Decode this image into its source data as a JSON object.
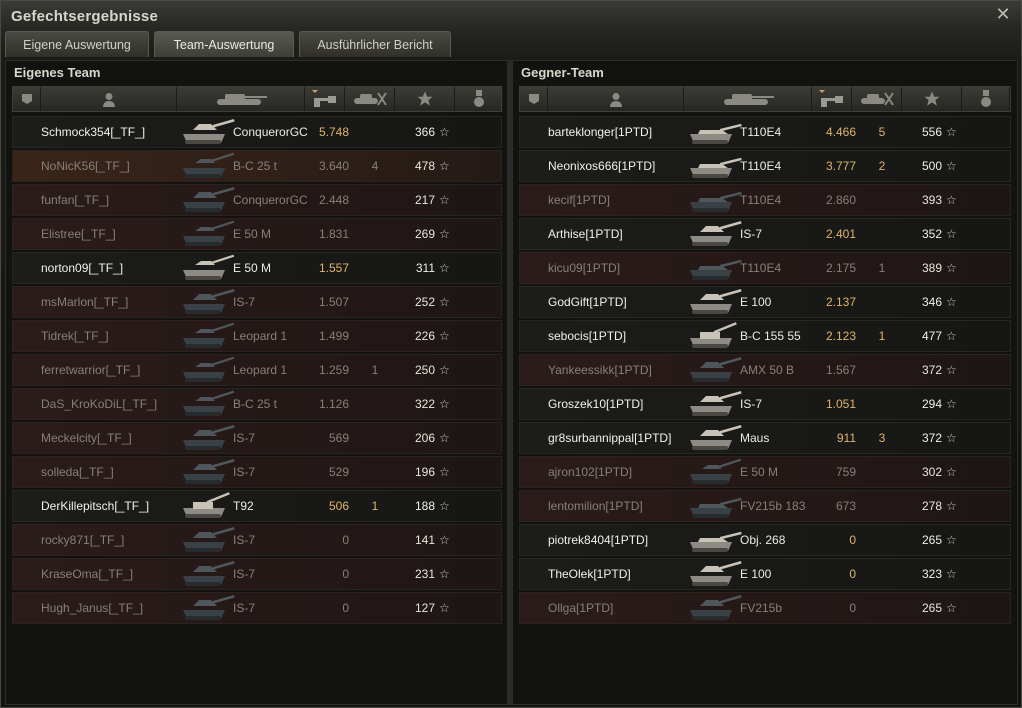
{
  "window": {
    "title": "Gefechtsergebnisse",
    "close_icon": "close-icon"
  },
  "tabs": [
    {
      "label": "Eigene Auswertung",
      "active": false
    },
    {
      "label": "Team-Auswertung",
      "active": true
    },
    {
      "label": "Ausführlicher Bericht",
      "active": false
    }
  ],
  "colors": {
    "damage": "#e0b36a",
    "dead_row": "#2a1c1a",
    "alive_row": "#1c1c1a"
  },
  "own_team": {
    "title": "Eigenes Team",
    "players": [
      {
        "name": "Schmock354[_TF_]",
        "vehicle": "ConquerorGC",
        "damage": "5.748",
        "kills": "",
        "xp": "366",
        "alive": true,
        "tank": "heavy"
      },
      {
        "name": "NoNicK56[_TF_]",
        "vehicle": "B-C 25 t",
        "damage": "3.640",
        "kills": "4",
        "xp": "478",
        "alive": false,
        "tank": "medium",
        "highlight": true
      },
      {
        "name": "funfan[_TF_]",
        "vehicle": "ConquerorGC",
        "damage": "2.448",
        "kills": "",
        "xp": "217",
        "alive": false,
        "tank": "heavy"
      },
      {
        "name": "Elistree[_TF_]",
        "vehicle": "E 50 M",
        "damage": "1.831",
        "kills": "",
        "xp": "269",
        "alive": false,
        "tank": "medium"
      },
      {
        "name": "norton09[_TF_]",
        "vehicle": "E 50 M",
        "damage": "1.557",
        "kills": "",
        "xp": "311",
        "alive": true,
        "tank": "medium"
      },
      {
        "name": "msMarlon[_TF_]",
        "vehicle": "IS-7",
        "damage": "1.507",
        "kills": "",
        "xp": "252",
        "alive": false,
        "tank": "heavy"
      },
      {
        "name": "Tidrek[_TF_]",
        "vehicle": "Leopard 1",
        "damage": "1.499",
        "kills": "",
        "xp": "226",
        "alive": false,
        "tank": "medium"
      },
      {
        "name": "ferretwarrior[_TF_]",
        "vehicle": "Leopard 1",
        "damage": "1.259",
        "kills": "1",
        "xp": "250",
        "alive": false,
        "tank": "medium"
      },
      {
        "name": "DaS_KroKoDiL[_TF_]",
        "vehicle": "B-C 25 t",
        "damage": "1.126",
        "kills": "",
        "xp": "322",
        "alive": false,
        "tank": "medium"
      },
      {
        "name": "Meckelcity[_TF_]",
        "vehicle": "IS-7",
        "damage": "569",
        "kills": "",
        "xp": "206",
        "alive": false,
        "tank": "heavy"
      },
      {
        "name": "solleda[_TF_]",
        "vehicle": "IS-7",
        "damage": "529",
        "kills": "",
        "xp": "196",
        "alive": false,
        "tank": "heavy"
      },
      {
        "name": "DerKillepitsch[_TF_]",
        "vehicle": "T92",
        "damage": "506",
        "kills": "1",
        "xp": "188",
        "alive": true,
        "tank": "spg"
      },
      {
        "name": "rocky871[_TF_]",
        "vehicle": "IS-7",
        "damage": "0",
        "kills": "",
        "xp": "141",
        "alive": false,
        "tank": "heavy"
      },
      {
        "name": "KraseOma[_TF_]",
        "vehicle": "IS-7",
        "damage": "0",
        "kills": "",
        "xp": "231",
        "alive": false,
        "tank": "heavy"
      },
      {
        "name": "Hugh_Janus[_TF_]",
        "vehicle": "IS-7",
        "damage": "0",
        "kills": "",
        "xp": "127",
        "alive": false,
        "tank": "heavy"
      }
    ]
  },
  "enemy_team": {
    "title": "Gegner-Team",
    "players": [
      {
        "name": "barteklonger[1PTD]",
        "vehicle": "T110E4",
        "damage": "4.466",
        "kills": "5",
        "xp": "556",
        "alive": true,
        "tank": "td"
      },
      {
        "name": "Neonixos666[1PTD]",
        "vehicle": "T110E4",
        "damage": "3.777",
        "kills": "2",
        "xp": "500",
        "alive": true,
        "tank": "td"
      },
      {
        "name": "kecif[1PTD]",
        "vehicle": "T110E4",
        "damage": "2.860",
        "kills": "",
        "xp": "393",
        "alive": false,
        "tank": "td"
      },
      {
        "name": "Arthise[1PTD]",
        "vehicle": "IS-7",
        "damage": "2.401",
        "kills": "",
        "xp": "352",
        "alive": true,
        "tank": "heavy"
      },
      {
        "name": "kicu09[1PTD]",
        "vehicle": "T110E4",
        "damage": "2.175",
        "kills": "1",
        "xp": "389",
        "alive": false,
        "tank": "td"
      },
      {
        "name": "GodGift[1PTD]",
        "vehicle": "E 100",
        "damage": "2.137",
        "kills": "",
        "xp": "346",
        "alive": true,
        "tank": "heavy"
      },
      {
        "name": "sebocis[1PTD]",
        "vehicle": "B-C 155 55",
        "damage": "2.123",
        "kills": "1",
        "xp": "477",
        "alive": true,
        "tank": "spg"
      },
      {
        "name": "Yankeessikk[1PTD]",
        "vehicle": "AMX 50 B",
        "damage": "1.567",
        "kills": "",
        "xp": "372",
        "alive": false,
        "tank": "heavy"
      },
      {
        "name": "Groszek10[1PTD]",
        "vehicle": "IS-7",
        "damage": "1.051",
        "kills": "",
        "xp": "294",
        "alive": true,
        "tank": "heavy"
      },
      {
        "name": "gr8surbannippal[1PTD]",
        "vehicle": "Maus",
        "damage": "911",
        "kills": "3",
        "xp": "372",
        "alive": true,
        "tank": "heavy"
      },
      {
        "name": "ajron102[1PTD]",
        "vehicle": "E 50 M",
        "damage": "759",
        "kills": "",
        "xp": "302",
        "alive": false,
        "tank": "medium"
      },
      {
        "name": "lentomilion[1PTD]",
        "vehicle": "FV215b 183",
        "damage": "673",
        "kills": "",
        "xp": "278",
        "alive": false,
        "tank": "td"
      },
      {
        "name": "piotrek8404[1PTD]",
        "vehicle": "Obj. 268",
        "damage": "0",
        "kills": "",
        "xp": "265",
        "alive": true,
        "tank": "td"
      },
      {
        "name": "TheOlek[1PTD]",
        "vehicle": "E 100",
        "damage": "0",
        "kills": "",
        "xp": "323",
        "alive": true,
        "tank": "heavy"
      },
      {
        "name": "Ollga[1PTD]",
        "vehicle": "FV215b",
        "damage": "0",
        "kills": "",
        "xp": "265",
        "alive": false,
        "tank": "heavy"
      }
    ]
  },
  "columns": [
    {
      "icon": "squad-icon"
    },
    {
      "icon": "player-icon"
    },
    {
      "icon": "tank-icon"
    },
    {
      "icon": "damage-sort-icon"
    },
    {
      "icon": "kills-icon"
    },
    {
      "icon": "xp-star-icon"
    },
    {
      "icon": "medal-icon"
    }
  ],
  "star_glyph": "☆"
}
